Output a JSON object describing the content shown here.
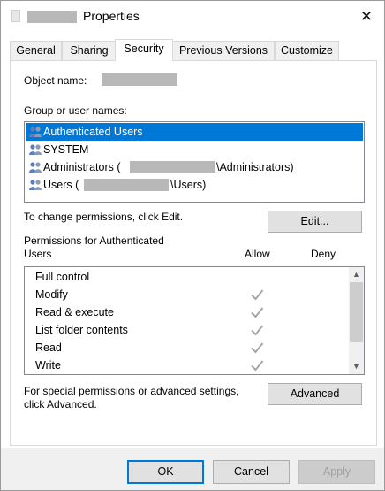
{
  "window": {
    "title": "Properties",
    "close_glyph": "✕"
  },
  "tabs": [
    {
      "label": "General"
    },
    {
      "label": "Sharing"
    },
    {
      "label": "Security"
    },
    {
      "label": "Previous Versions"
    },
    {
      "label": "Customize"
    }
  ],
  "security": {
    "object_name_label": "Object name:",
    "group_label": "Group or user names:",
    "users": [
      {
        "name": "Authenticated Users",
        "selected": true
      },
      {
        "name": "SYSTEM"
      },
      {
        "name": "Administrators (",
        "suffix": "\\Administrators)"
      },
      {
        "name": "Users (",
        "suffix": "\\Users)"
      }
    ],
    "change_text": "To change permissions, click Edit.",
    "edit_button": "Edit...",
    "permissions_label_line1": "Permissions for Authenticated",
    "permissions_label_line2": "Users",
    "allow_header": "Allow",
    "deny_header": "Deny",
    "permissions": [
      {
        "name": "Full control",
        "allow": false
      },
      {
        "name": "Modify",
        "allow": true
      },
      {
        "name": "Read & execute",
        "allow": true
      },
      {
        "name": "List folder contents",
        "allow": true
      },
      {
        "name": "Read",
        "allow": true
      },
      {
        "name": "Write",
        "allow": true
      }
    ],
    "special_text_line1": "For special permissions or advanced settings,",
    "special_text_line2": "click Advanced.",
    "advanced_button": "Advanced"
  },
  "footer": {
    "ok": "OK",
    "cancel": "Cancel",
    "apply": "Apply"
  },
  "colors": {
    "selection": "#0078d7",
    "check": "#a6a6a6"
  },
  "icons": {
    "users": "users-icon",
    "check": "check-icon",
    "close": "close-icon"
  }
}
